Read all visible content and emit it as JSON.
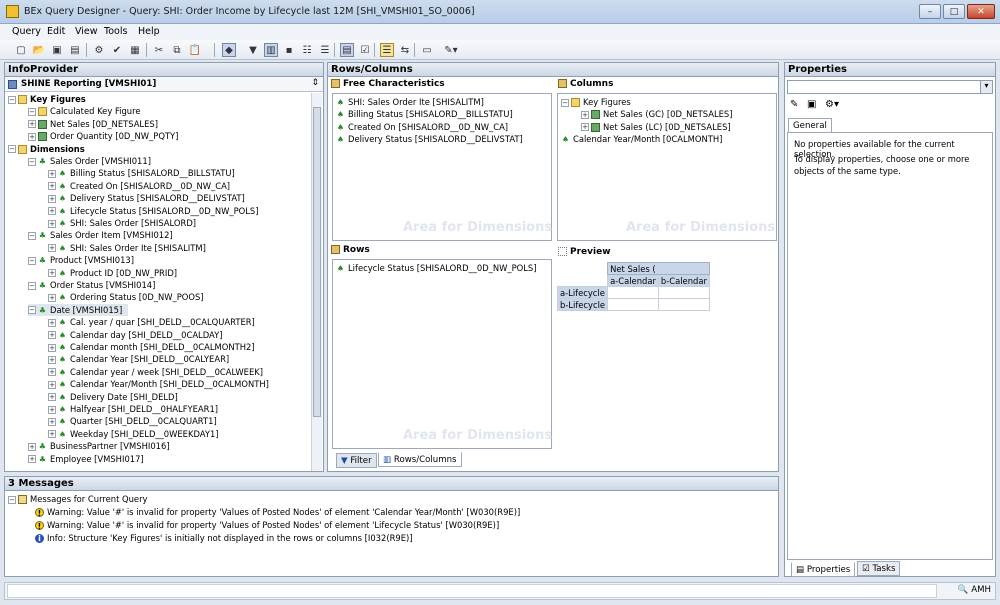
{
  "window": {
    "title": "BEx Query Designer - Query: SHI: Order Income by Lifecycle last 12M [SHI_VMSHI01_SO_0006]",
    "minimize": "–",
    "maximize": "□",
    "close": "✕"
  },
  "menu": [
    "Query",
    "Edit",
    "View",
    "Tools",
    "Help"
  ],
  "infoprovider": {
    "header": "InfoProvider",
    "selector": "SHINE Reporting [VMSHI01]",
    "tree": [
      {
        "label": "Key Figures",
        "level": 0,
        "kind": "folder",
        "bold": true
      },
      {
        "label": "Calculated Key Figure",
        "level": 1,
        "kind": "folder"
      },
      {
        "label": "Net Sales [0D_NETSALES]",
        "level": 1,
        "kind": "kf"
      },
      {
        "label": "Order Quantity [0D_NW_PQTY]",
        "level": 1,
        "kind": "kf"
      },
      {
        "label": "Dimensions",
        "level": 0,
        "kind": "folder",
        "bold": true
      },
      {
        "label": "Sales Order [VMSHI011]",
        "level": 1,
        "kind": "dim"
      },
      {
        "label": "Billing Status [SHISALORD__BILLSTATU]",
        "level": 2,
        "kind": "char"
      },
      {
        "label": "Created On [SHISALORD__0D_NW_CA]",
        "level": 2,
        "kind": "char"
      },
      {
        "label": "Delivery Status [SHISALORD__DELIVSTAT]",
        "level": 2,
        "kind": "char"
      },
      {
        "label": "Lifecycle Status [SHISALORD__0D_NW_POLS]",
        "level": 2,
        "kind": "char"
      },
      {
        "label": "SHI: Sales Order [SHISALORD]",
        "level": 2,
        "kind": "char"
      },
      {
        "label": "Sales Order Item [VMSHI012]",
        "level": 1,
        "kind": "dim"
      },
      {
        "label": "SHI: Sales Order Ite [SHISALITM]",
        "level": 2,
        "kind": "char"
      },
      {
        "label": "Product [VMSHI013]",
        "level": 1,
        "kind": "dim"
      },
      {
        "label": "Product ID [0D_NW_PRID]",
        "level": 2,
        "kind": "char"
      },
      {
        "label": "Order Status [VMSHI014]",
        "level": 1,
        "kind": "dim"
      },
      {
        "label": "Ordering Status [0D_NW_POOS]",
        "level": 2,
        "kind": "char"
      },
      {
        "label": "Date [VMSHI015]",
        "level": 1,
        "kind": "dim",
        "selected": true
      },
      {
        "label": "Cal. year / quar [SHI_DELD__0CALQUARTER]",
        "level": 2,
        "kind": "char"
      },
      {
        "label": "Calendar day [SHI_DELD__0CALDAY]",
        "level": 2,
        "kind": "char"
      },
      {
        "label": "Calendar month [SHI_DELD__0CALMONTH2]",
        "level": 2,
        "kind": "char"
      },
      {
        "label": "Calendar Year [SHI_DELD__0CALYEAR]",
        "level": 2,
        "kind": "char"
      },
      {
        "label": "Calendar year / week [SHI_DELD__0CALWEEK]",
        "level": 2,
        "kind": "char"
      },
      {
        "label": "Calendar Year/Month [SHI_DELD__0CALMONTH]",
        "level": 2,
        "kind": "char"
      },
      {
        "label": "Delivery Date [SHI_DELD]",
        "level": 2,
        "kind": "char"
      },
      {
        "label": "Halfyear [SHI_DELD__0HALFYEAR1]",
        "level": 2,
        "kind": "char"
      },
      {
        "label": "Quarter [SHI_DELD__0CALQUART1]",
        "level": 2,
        "kind": "char"
      },
      {
        "label": "Weekday [SHI_DELD__0WEEKDAY1]",
        "level": 2,
        "kind": "char"
      },
      {
        "label": "BusinessPartner [VMSHI016]",
        "level": 1,
        "kind": "dim"
      },
      {
        "label": "Employee [VMSHI017]",
        "level": 1,
        "kind": "dim"
      }
    ]
  },
  "rowscols": {
    "header": "Rows/Columns",
    "free": {
      "title": "Free Characteristics",
      "items": [
        "SHI: Sales Order Ite [SHISALITM]",
        "Billing Status [SHISALORD__BILLSTATU]",
        "Created On [SHISALORD__0D_NW_CA]",
        "Delivery Status [SHISALORD__DELIVSTAT]"
      ]
    },
    "columns": {
      "title": "Columns",
      "keyfig": "Key Figures",
      "items": [
        "Net Sales (GC) [0D_NETSALES]",
        "Net Sales (LC) [0D_NETSALES]"
      ],
      "caly": "Calendar Year/Month [0CALMONTH]"
    },
    "rows": {
      "title": "Rows",
      "items": [
        "Lifecycle Status [SHISALORD__0D_NW_POLS]"
      ]
    },
    "watermark": "Area for Dimensions",
    "preview": {
      "title": "Preview",
      "head": "Net Sales (",
      "cols": [
        "a-Calendar",
        "b-Calendar"
      ],
      "rows": [
        "a-Lifecycle",
        "b-Lifecycle"
      ]
    },
    "tabs": [
      "Filter",
      "Rows/Columns"
    ]
  },
  "properties": {
    "header": "Properties",
    "tab": "General",
    "msg1": "No properties available for the current selection.",
    "msg2": "To display properties, choose one or more objects of the same type.",
    "bottom_tabs": [
      "Properties",
      "Tasks"
    ]
  },
  "messages": {
    "header": "3 Messages",
    "root": "Messages for Current Query",
    "items": [
      {
        "type": "warning",
        "text": "Warning: Value '#' is invalid for property 'Values of Posted Nodes' of element 'Calendar Year/Month' [W030(R9E)]"
      },
      {
        "type": "warning",
        "text": "Warning: Value '#' is invalid for property 'Values of Posted Nodes' of element 'Lifecycle Status' [W030(R9E)]"
      },
      {
        "type": "info",
        "text": "Info: Structure 'Key Figures' is initially not displayed in the rows or columns [I032(R9E)]"
      }
    ]
  },
  "statusbar": {
    "user": "AMH"
  },
  "colors": {
    "panel_header": "#cdd7e4",
    "title": "#b9cde6",
    "selected": "#dfe6ee"
  }
}
